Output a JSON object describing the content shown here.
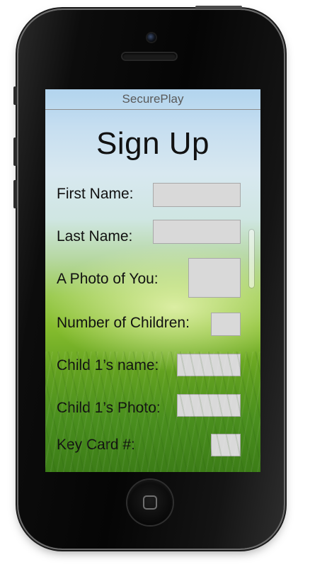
{
  "app": {
    "title": "SecurePlay"
  },
  "form": {
    "heading": "Sign Up",
    "fields": [
      {
        "label": "First Name:",
        "type": "text",
        "value": ""
      },
      {
        "label": "Last Name:",
        "type": "text",
        "value": ""
      },
      {
        "label": "A Photo of You:",
        "type": "photo",
        "value": ""
      },
      {
        "label": "Number of Children:",
        "type": "number",
        "value": ""
      },
      {
        "label": "Child 1’s name:",
        "type": "text",
        "value": ""
      },
      {
        "label": "Child 1’s Photo:",
        "type": "photo",
        "value": ""
      },
      {
        "label": "Key Card #:",
        "type": "text",
        "value": ""
      }
    ]
  },
  "colors": {
    "field_fill": "#d9d9d9",
    "field_border": "#a8a8a8",
    "text": "#111111",
    "title_text": "#5a5a5a",
    "phone_body": "#0c0c0c"
  },
  "icons": {
    "home_button": "home-button-icon",
    "camera": "front-camera-icon",
    "speaker": "speaker-grille-icon"
  }
}
